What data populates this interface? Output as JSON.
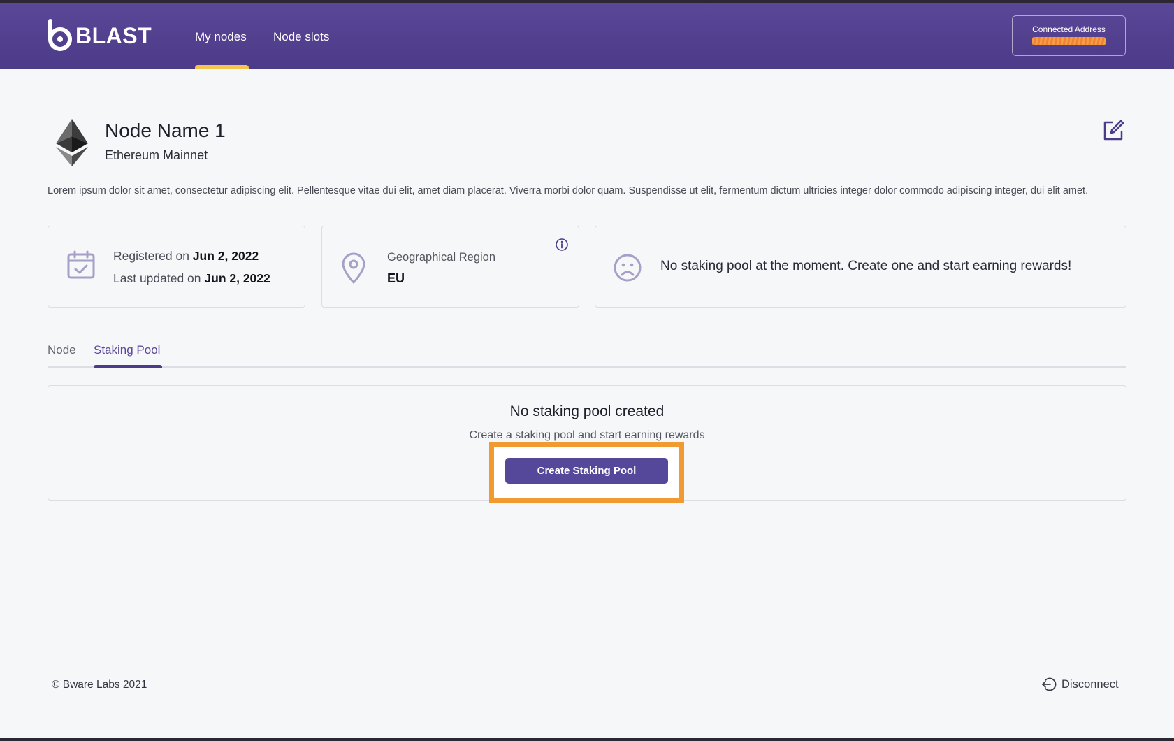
{
  "header": {
    "logo_text": "BLAST",
    "nav": [
      {
        "label": "My nodes",
        "active": true
      },
      {
        "label": "Node slots",
        "active": false
      }
    ],
    "address": {
      "label": "Connected Address",
      "value_redacted": "0x00000000"
    }
  },
  "node": {
    "name": "Node Name 1",
    "network": "Ethereum Mainnet",
    "description": "Lorem ipsum dolor sit amet, consectetur adipiscing elit. Pellentesque vitae dui elit, amet diam placerat. Viverra morbi dolor quam. Suspendisse ut elit, fermentum dictum ultricies integer dolor commodo adipiscing integer, dui elit amet."
  },
  "cards": {
    "registered": {
      "registered_label": "Registered on ",
      "registered_date": "Jun 2, 2022",
      "updated_label": "Last updated on ",
      "updated_date": "Jun 2, 2022"
    },
    "region": {
      "label": "Geographical Region",
      "value": "EU"
    },
    "pool_status": {
      "message": "No staking pool at the moment. Create one and start earning rewards!"
    }
  },
  "tabs": [
    {
      "label": "Node",
      "active": false
    },
    {
      "label": "Staking Pool",
      "active": true
    }
  ],
  "empty_state": {
    "title": "No staking pool created",
    "subtitle": "Create a staking pool and start earning rewards",
    "button_label": "Create Staking Pool"
  },
  "footer": {
    "copyright": "© Bware Labs 2021",
    "disconnect_label": "Disconnect"
  },
  "colors": {
    "header_bg": "#4c3b88",
    "accent": "#55479a",
    "nav_underline": "#f6c34d",
    "highlight": "#f09a31",
    "icon_muted": "#a79fc7"
  },
  "icons": {
    "network": "ethereum-icon",
    "edit": "edit-icon",
    "calendar": "calendar-check-icon",
    "region": "map-pin-icon",
    "info": "info-icon",
    "pool_status": "sad-face-icon",
    "disconnect": "logout-icon"
  }
}
